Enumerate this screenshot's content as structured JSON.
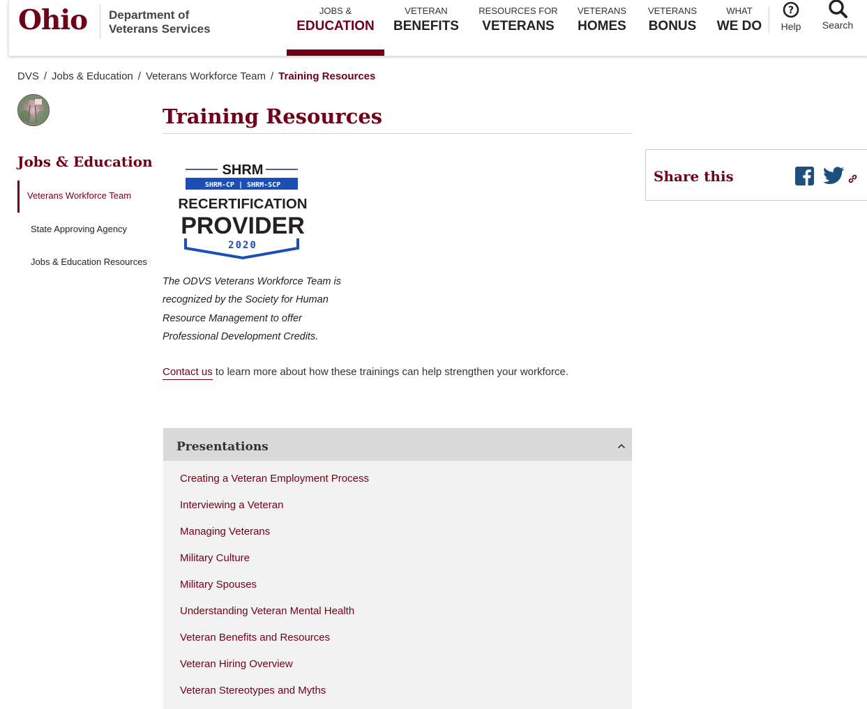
{
  "header": {
    "logo_text": "Ohio",
    "dept_line1": "Department of",
    "dept_line2": "Veterans Services",
    "nav": [
      {
        "small": "JOBS &",
        "big": "EDUCATION"
      },
      {
        "small": "VETERAN",
        "big": "BENEFITS"
      },
      {
        "small": "RESOURCES FOR",
        "big": "VETERANS"
      },
      {
        "small": "VETERANS",
        "big": "HOMES"
      },
      {
        "small": "VETERANS",
        "big": "BONUS"
      },
      {
        "small": "WHAT",
        "big": "WE DO"
      }
    ],
    "help_label": "Help",
    "search_label": "Search",
    "brand_color": "#700017"
  },
  "breadcrumb": {
    "items": [
      "DVS",
      "Jobs & Education",
      "Veterans Workforce Team"
    ],
    "current": "Training Resources",
    "separator": "/"
  },
  "sidebar": {
    "heading": "Jobs & Education",
    "links": [
      "Veterans Workforce Team",
      "State Approving Agency",
      "Jobs & Education Resources"
    ]
  },
  "main": {
    "title": "Training Resources",
    "badge": {
      "top": "SHRM",
      "bar": "SHRM-CP | SHRM-SCP",
      "line1": "RECERTIFICATION",
      "line2": "PROVIDER",
      "year": "2020"
    },
    "intro_lines": [
      "The ODVS Veterans Workforce Team is",
      "recognized by the Society for Human",
      "Resource Management to offer",
      "Professional Development Credits."
    ],
    "contact_link": "Contact us",
    "contact_rest": " to learn more about how these trainings can help strengthen your workforce."
  },
  "accordion": {
    "title": "Presentations",
    "items": [
      "Creating a Veteran Employment Process",
      "Interviewing a Veteran",
      "Managing Veterans",
      "Military Culture",
      "Military Spouses",
      "Understanding Veteran Mental Health",
      "Veteran Benefits and Resources",
      "Veteran Hiring Overview",
      "Veteran Stereotypes and Myths"
    ]
  },
  "share": {
    "title": "Share this",
    "icons": [
      "facebook-icon",
      "twitter-icon",
      "link-icon"
    ]
  }
}
